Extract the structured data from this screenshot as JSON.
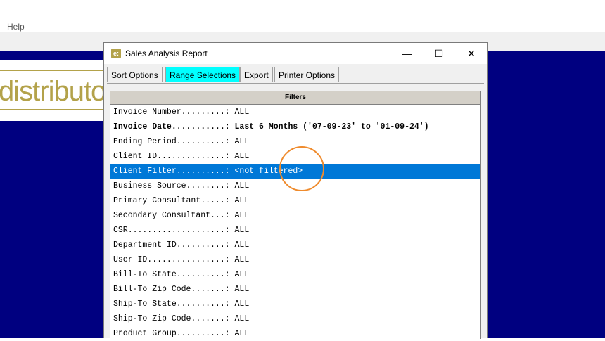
{
  "menubar": {
    "help_label": "Help"
  },
  "logo": {
    "text": "distributor"
  },
  "dialog": {
    "title": "Sales Analysis Report",
    "app_icon": "e:",
    "minimize_glyph": "—",
    "maximize_glyph": "☐",
    "close_glyph": "✕",
    "tabs": [
      {
        "label": "Sort Options"
      },
      {
        "label": "Range Selections"
      },
      {
        "label": "Export"
      },
      {
        "label": "Printer Options"
      }
    ],
    "active_tab": "Range Selections",
    "filters": {
      "header": "Filters",
      "rows": [
        {
          "text": "Invoice Number.........: ALL"
        },
        {
          "text": "Invoice Date...........: Last 6 Months ('07-09-23' to '01-09-24')"
        },
        {
          "text": "Ending Period..........: ALL"
        },
        {
          "text": "Client ID..............: ALL"
        },
        {
          "text": "Client Filter..........: <not filtered>"
        },
        {
          "text": "Business Source........: ALL"
        },
        {
          "text": "Primary Consultant.....: ALL"
        },
        {
          "text": "Secondary Consultant...: ALL"
        },
        {
          "text": "CSR....................: ALL"
        },
        {
          "text": "Department ID..........: ALL"
        },
        {
          "text": "User ID................: ALL"
        },
        {
          "text": "Bill-To State..........: ALL"
        },
        {
          "text": "Bill-To Zip Code.......: ALL"
        },
        {
          "text": "Ship-To State..........: ALL"
        },
        {
          "text": "Ship-To Zip Code.......: ALL"
        },
        {
          "text": "Product Group..........: ALL"
        }
      ],
      "selected_row": "Client Filter..........: <not filtered>"
    }
  },
  "colors": {
    "background": "#000080",
    "selection": "#0078d7",
    "active_tab": "#00ffff",
    "logo_gold": "#b3a24a",
    "highlight_circle": "#ef8b2d"
  }
}
